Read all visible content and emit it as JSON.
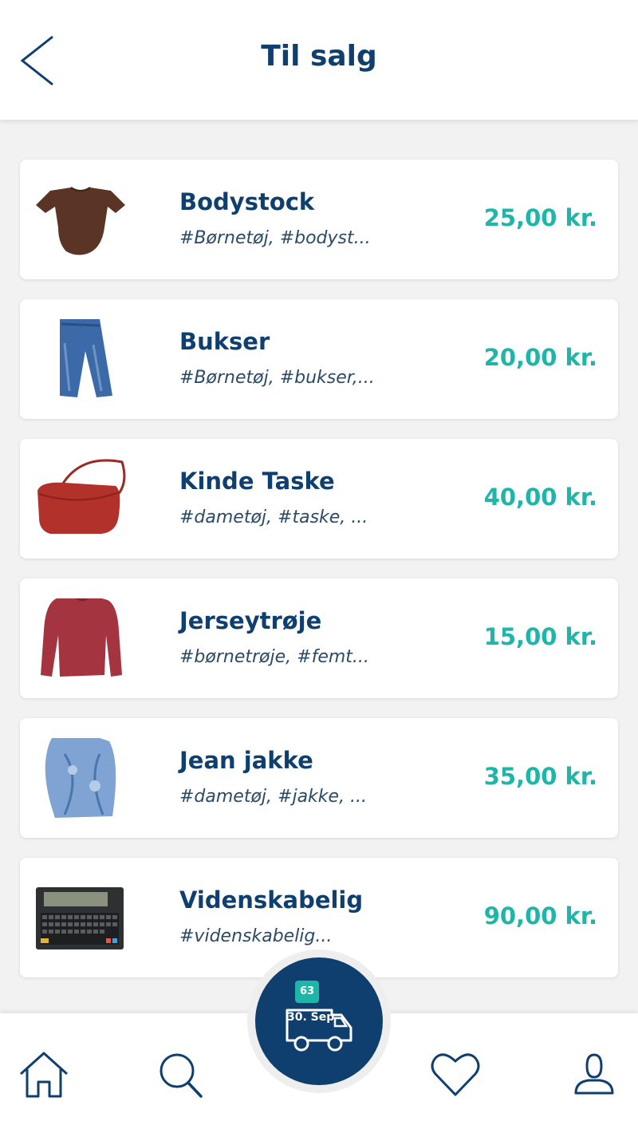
{
  "header": {
    "title": "Til salg"
  },
  "items": [
    {
      "title": "Bodystock",
      "tags": "#Børnetøj, #bodyst...",
      "price": "25,00 kr."
    },
    {
      "title": "Bukser",
      "tags": "#Børnetøj, #bukser,...",
      "price": "20,00 kr."
    },
    {
      "title": "Kinde Taske",
      "tags": "#dametøj, #taske, ...",
      "price": "40,00 kr."
    },
    {
      "title": "Jerseytrøje",
      "tags": "#børnetrøje, #femt...",
      "price": "15,00 kr."
    },
    {
      "title": "Jean jakke",
      "tags": "#dametøj, #jakke, ...",
      "price": "35,00 kr."
    },
    {
      "title": "Videnskabelig",
      "tags": "#videnskabelig...",
      "price": "90,00 kr."
    }
  ],
  "delivery": {
    "badge_count": "63",
    "date": "30. Sep"
  },
  "nav": {
    "icons": [
      "home-icon",
      "search-icon",
      "truck-icon",
      "heart-icon",
      "user-icon"
    ]
  },
  "colors": {
    "primary": "#0f3f6e",
    "accent": "#1fb5a8",
    "background": "#f2f2f2"
  }
}
